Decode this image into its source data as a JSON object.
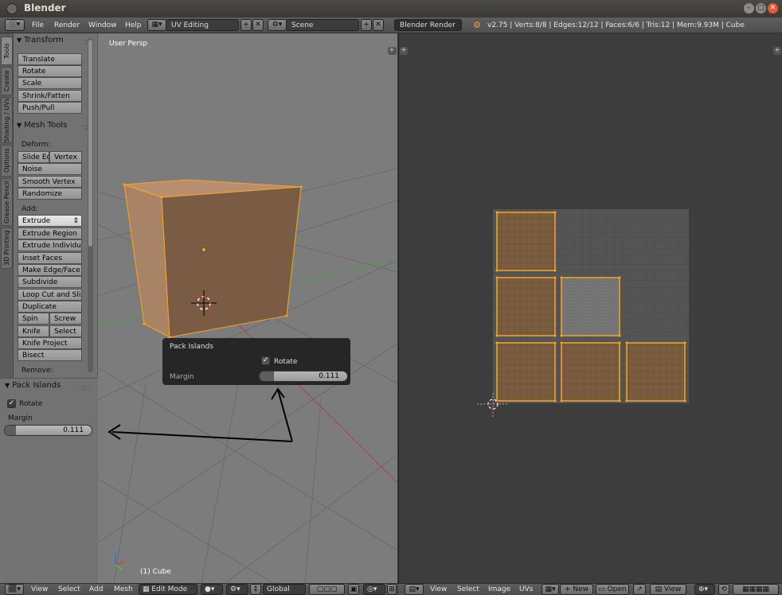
{
  "window": {
    "title": "Blender"
  },
  "menu": {
    "file": "File",
    "render": "Render",
    "window": "Window",
    "help": "Help"
  },
  "layout_name": "UV Editing",
  "scene_name": "Scene",
  "render_engine": "Blender Render",
  "stats": "v2.75 | Verts:8/8 | Edges:12/12 | Faces:6/6 | Tris:12 | Mem:9.93M | Cube",
  "tabs": [
    "Tools",
    "Create",
    "Shading / UVs",
    "Options",
    "Grease Pencil",
    "3D Printing"
  ],
  "transform": {
    "title": "Transform",
    "buttons": [
      "Translate",
      "Rotate",
      "Scale",
      "Shrink/Fatten",
      "Push/Pull"
    ]
  },
  "mesh_tools": {
    "title": "Mesh Tools",
    "deform_label": "Deform:",
    "slide_edge": "Slide Ed",
    "vertex": "Vertex",
    "noise": "Noise",
    "smooth_vertex": "Smooth Vertex",
    "randomize": "Randomize",
    "add_label": "Add:",
    "extrude": "Extrude",
    "extrude_region": "Extrude Region",
    "extrude_individual": "Extrude Individual",
    "inset_faces": "Inset Faces",
    "make_edge_face": "Make Edge/Face",
    "subdivide": "Subdivide",
    "loop_cut": "Loop Cut and Slide",
    "duplicate": "Duplicate",
    "spin": "Spin",
    "screw": "Screw",
    "knife": "Knife",
    "select": "Select",
    "knife_project": "Knife Project",
    "bisect": "Bisect",
    "remove_label": "Remove:"
  },
  "operator": {
    "title": "Pack Islands",
    "rotate_label": "Rotate",
    "margin_label": "Margin",
    "margin_value": "0.111"
  },
  "viewport": {
    "view_name": "User Persp",
    "object_label": "(1) Cube"
  },
  "popup": {
    "title": "Pack Islands",
    "rotate_label": "Rotate",
    "margin_label": "Margin",
    "margin_value": "0.111"
  },
  "view3d_header": {
    "view": "View",
    "select": "Select",
    "add": "Add",
    "mesh": "Mesh",
    "mode": "Edit Mode",
    "orientation": "Global"
  },
  "uv_header": {
    "view": "View",
    "select": "Select",
    "image": "Image",
    "uvs": "UVs",
    "new": "New",
    "open": "Open",
    "view2": "View"
  },
  "colors": {
    "selection": "#f5a623",
    "face": "#7a5c3e",
    "viewport_bg": "#7c7c7c",
    "uv_bg": "#3d3d3d"
  }
}
